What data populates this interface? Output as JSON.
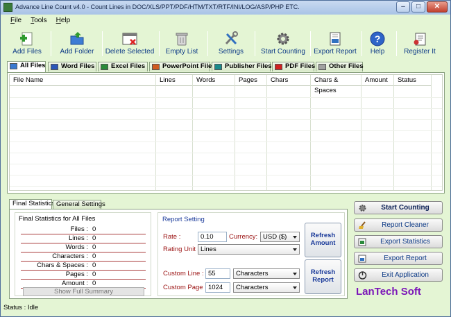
{
  "window": {
    "title": "Advance Line Count v4.0 - Count Lines in DOC/XLS/PPT/PDF/HTM/TXT/RTF/INI/LOG/ASP/PHP ETC.",
    "minimize": "–",
    "maximize": "□",
    "close": "✕"
  },
  "menu": [
    {
      "first": "F",
      "rest": "ile"
    },
    {
      "first": "T",
      "rest": "ools"
    },
    {
      "first": "H",
      "rest": "elp"
    }
  ],
  "toolbar": {
    "add_files": "Add Files",
    "add_folder": "Add Folder",
    "delete_selected": "Delete Selected",
    "empty_list": "Empty List",
    "settings": "Settings",
    "start_counting": "Start Counting",
    "export_report": "Export Report",
    "help": "Help",
    "register": "Register It"
  },
  "file_tabs": [
    "All Files",
    "Word Files",
    "Excel Files",
    "PowerPoint Files",
    "Publisher Files",
    "PDF Files",
    "Other Files"
  ],
  "grid": {
    "columns": [
      "File Name",
      "Lines",
      "Words",
      "Pages",
      "Chars",
      "Chars & Spaces",
      "Amount",
      "Status"
    ]
  },
  "bottom_tabs": [
    "Final Statistics",
    "General Settings"
  ],
  "stats": {
    "title": "Final Statistics for All Files",
    "rows": [
      {
        "label": "Files :",
        "value": "0"
      },
      {
        "label": "Lines :",
        "value": "0"
      },
      {
        "label": "Words :",
        "value": "0"
      },
      {
        "label": "Characters :",
        "value": "0"
      },
      {
        "label": "Chars & Spaces :",
        "value": "0"
      },
      {
        "label": "Pages :",
        "value": "0"
      },
      {
        "label": "Amount :",
        "value": "0"
      }
    ],
    "summary_button": "Show Full Summary"
  },
  "report": {
    "legend": "Report Setting",
    "rate_label": "Rate :",
    "rate_value": "0.10",
    "currency_label": "Currency:",
    "currency_value": "USD ($)",
    "rating_unit_label": "Rating Unit :",
    "rating_unit_value": "Lines",
    "custom_line_label": "Custom Line :",
    "custom_line_value": "55",
    "custom_line_unit": "Characters",
    "custom_page_label": "Custom Page :",
    "custom_page_value": "1024",
    "custom_page_unit": "Characters",
    "refresh_amount_1": "Refresh",
    "refresh_amount_2": "Amount",
    "refresh_report_1": "Refresh",
    "refresh_report_2": "Report"
  },
  "side_buttons": {
    "start_counting": "Start Counting",
    "report_cleaner": "Report Cleaner",
    "export_statistics": "Export Statistics",
    "export_report": "Export Report",
    "exit": "Exit Application"
  },
  "brand": "LanTech Soft",
  "status": "Status : Idle"
}
